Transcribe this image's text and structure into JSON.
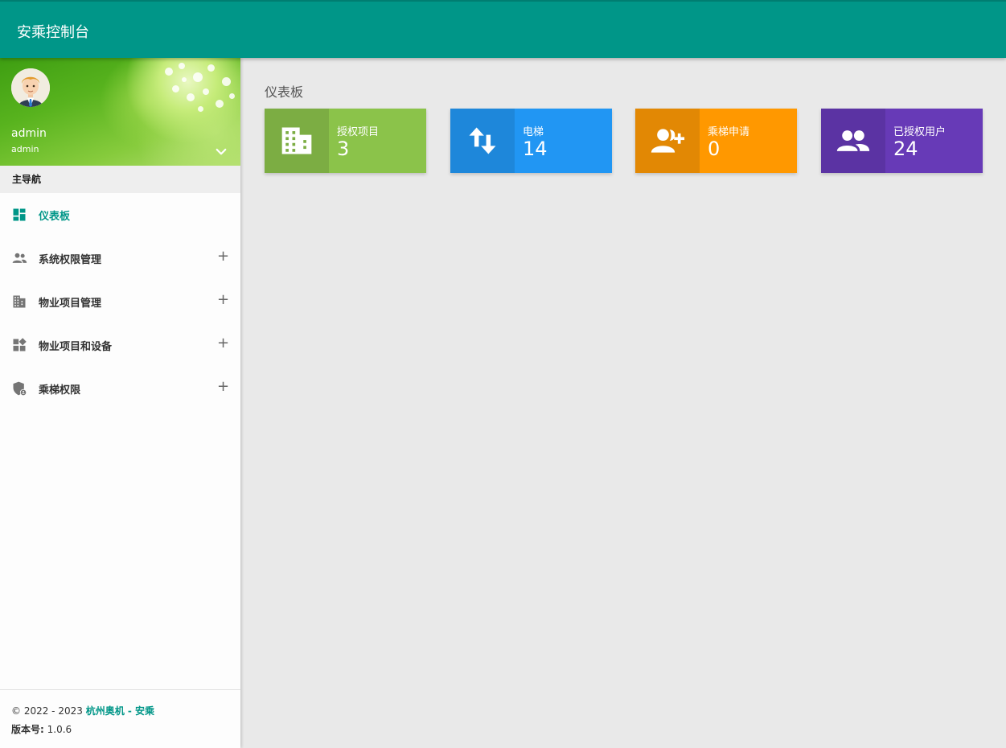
{
  "app": {
    "title": "安乘控制台"
  },
  "user": {
    "name": "admin",
    "role": "admin"
  },
  "nav": {
    "header": "主导航",
    "items": [
      {
        "label": "仪表板",
        "icon": "dashboard-icon",
        "active": true
      },
      {
        "label": "系统权限管理",
        "icon": "people-icon",
        "expand": "+"
      },
      {
        "label": "物业项目管理",
        "icon": "building-icon",
        "expand": "+"
      },
      {
        "label": "物业项目和设备",
        "icon": "widgets-icon",
        "expand": "+"
      },
      {
        "label": "乘梯权限",
        "icon": "shield-user-icon",
        "expand": "+"
      }
    ]
  },
  "footer": {
    "copyright": "© 2022 - 2023",
    "brand": "杭州奥机 - 安乘",
    "version_label": "版本号:",
    "version": "1.0.6"
  },
  "page": {
    "title": "仪表板"
  },
  "cards": [
    {
      "label": "授权项目",
      "value": "3",
      "icon": "building-icon",
      "color": "#8bc34a",
      "icon_bg": "#7cad43"
    },
    {
      "label": "电梯",
      "value": "14",
      "icon": "up-down-arrows-icon",
      "color": "#2196f3",
      "icon_bg": "#1e87da"
    },
    {
      "label": "乘梯申请",
      "value": "0",
      "icon": "person-add-icon",
      "color": "#ff9800",
      "icon_bg": "#e28804"
    },
    {
      "label": "已授权用户",
      "value": "24",
      "icon": "group-icon",
      "color": "#673ab7",
      "icon_bg": "#5b33a3"
    }
  ],
  "colors": {
    "primary": "#009688",
    "background": "#e9e9e9"
  }
}
